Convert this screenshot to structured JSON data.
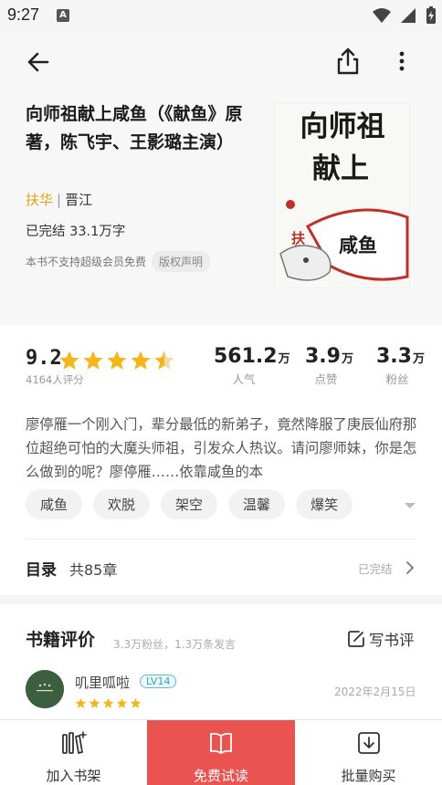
{
  "status_bar": {
    "time": "9:27",
    "notif_letter": "A"
  },
  "book": {
    "title": "向师祖献上咸鱼（《献鱼》原著，陈飞宇、王影璐主演）",
    "author": "扶华",
    "publisher": "晋江",
    "status": "已完结 33.1万字",
    "vip_note": "本书不支持超级会员免费",
    "copyright_label": "版权声明",
    "cover": {
      "line1": "向师祖",
      "line2": "献上",
      "seal": "扶华",
      "tag": "咸鱼"
    }
  },
  "stats": {
    "rating": "9.2",
    "stars": 4.5,
    "rating_count": "4164人评分",
    "popularity": {
      "value": "561.2",
      "unit": "万",
      "label": "人气"
    },
    "likes": {
      "value": "3.9",
      "unit": "万",
      "label": "点赞"
    },
    "fans": {
      "value": "3.3",
      "unit": "万",
      "label": "粉丝"
    }
  },
  "intro": "廖停雁一个刚入门，辈分最低的新弟子，竟然降服了庚辰仙府那位超绝可怕的大魔头师祖，引发众人热议。请问廖师妹，你是怎么做到的呢？廖停雁……依靠咸鱼的本",
  "tags": [
    "咸鱼",
    "欢脱",
    "架空",
    "温馨",
    "爆笑"
  ],
  "toc": {
    "label": "目录",
    "count": "共85章",
    "status": "已完结"
  },
  "reviews": {
    "title": "书籍评价",
    "meta": "3.3万粉丝，1.3万条发言",
    "write_label": "写书评",
    "items": [
      {
        "name": "叽里呱啦",
        "level": "LV14",
        "stars": 5,
        "date": "2022年2月15日"
      }
    ]
  },
  "bottom_bar": {
    "add_shelf": "加入书架",
    "free_trial": "免费试读",
    "bulk_buy": "批量购买"
  },
  "colors": {
    "accent_red": "#e95350",
    "author_gold": "#e8a319",
    "star": "#f5b51c"
  }
}
